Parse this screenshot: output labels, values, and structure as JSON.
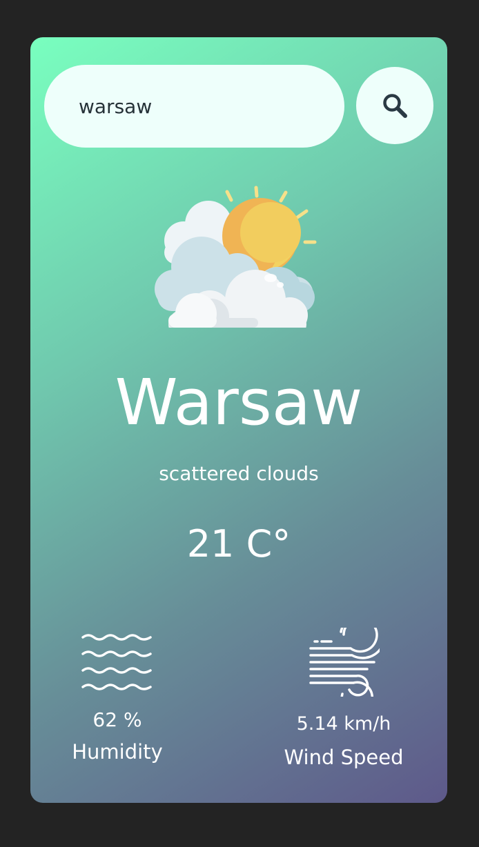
{
  "search": {
    "value": "warsaw",
    "icon": "search-icon"
  },
  "weather": {
    "icon": "cloud-sun-icon",
    "city": "Warsaw",
    "description": "scattered clouds",
    "temperature": "21 C°"
  },
  "humidity": {
    "icon": "humidity-waves-icon",
    "value": "62 %",
    "label": "Humidity"
  },
  "wind": {
    "icon": "wind-icon",
    "value": "5.14 km/h",
    "label": "Wind Speed"
  },
  "colors": {
    "page_background": "#232323",
    "gradient_start": "#79ffbf",
    "gradient_end": "#5e598a",
    "input_background": "#eefffb",
    "text": "#ffffff"
  }
}
